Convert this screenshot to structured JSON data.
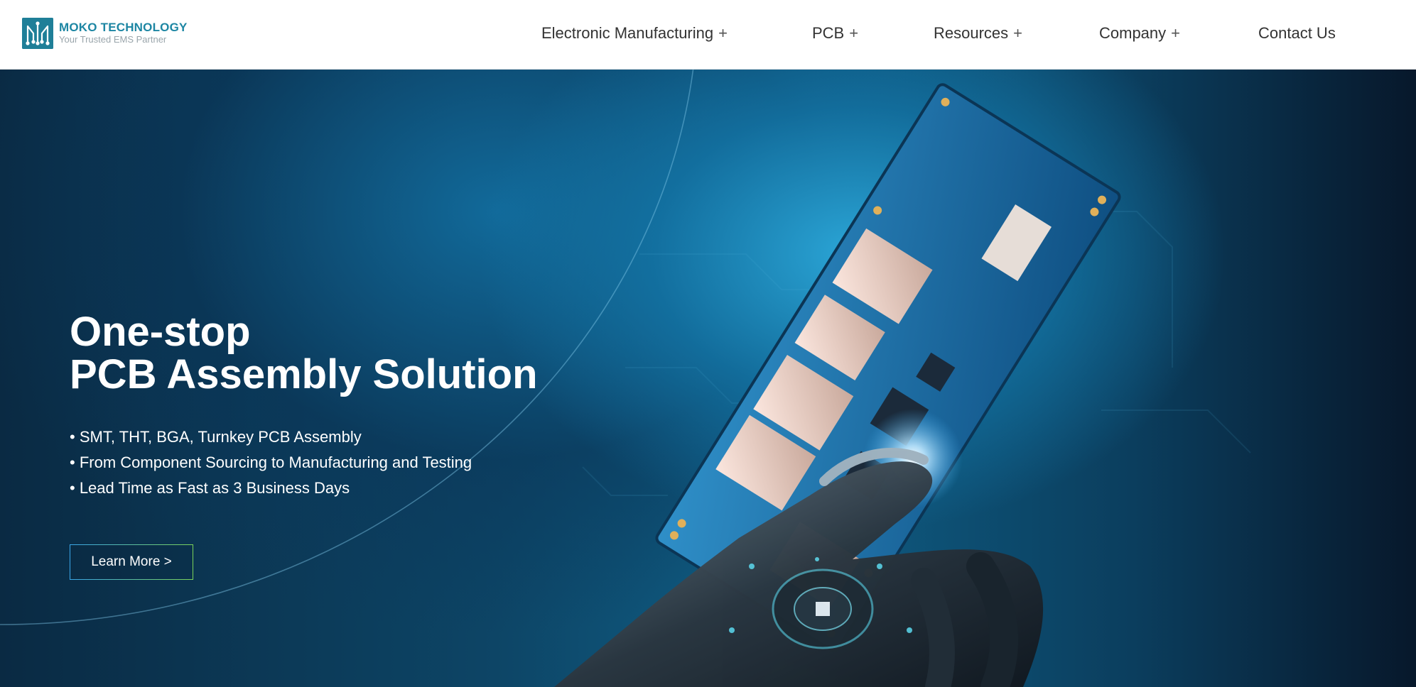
{
  "brand": {
    "name": "MOKO TECHNOLOGY",
    "tagline": "Your Trusted EMS Partner",
    "logo_icon": "circuit-logo-icon",
    "colors": {
      "primary": "#1d86a3",
      "tagline": "#9aa5ab"
    }
  },
  "nav": {
    "items": [
      {
        "label": "Electronic Manufacturing",
        "expand": "+"
      },
      {
        "label": "PCB",
        "expand": "+"
      },
      {
        "label": "Resources",
        "expand": "+"
      },
      {
        "label": "Company",
        "expand": "+"
      },
      {
        "label": "Contact Us",
        "expand": ""
      }
    ]
  },
  "hero": {
    "title_line1": "One-stop",
    "title_line2": "PCB Assembly Solution",
    "bullets": [
      "• SMT, THT, BGA, Turnkey PCB Assembly",
      "• From Component Sourcing to Manufacturing and Testing",
      "• Lead Time as Fast as 3 Business Days"
    ],
    "cta_label": "Learn More >",
    "image": "robot-hand-touching-pcb-illustration",
    "colors": {
      "background_dark": "#0a2a43",
      "glow": "#2caadc",
      "cta_start": "#3aa6e8",
      "cta_end": "#7bd35a"
    }
  }
}
